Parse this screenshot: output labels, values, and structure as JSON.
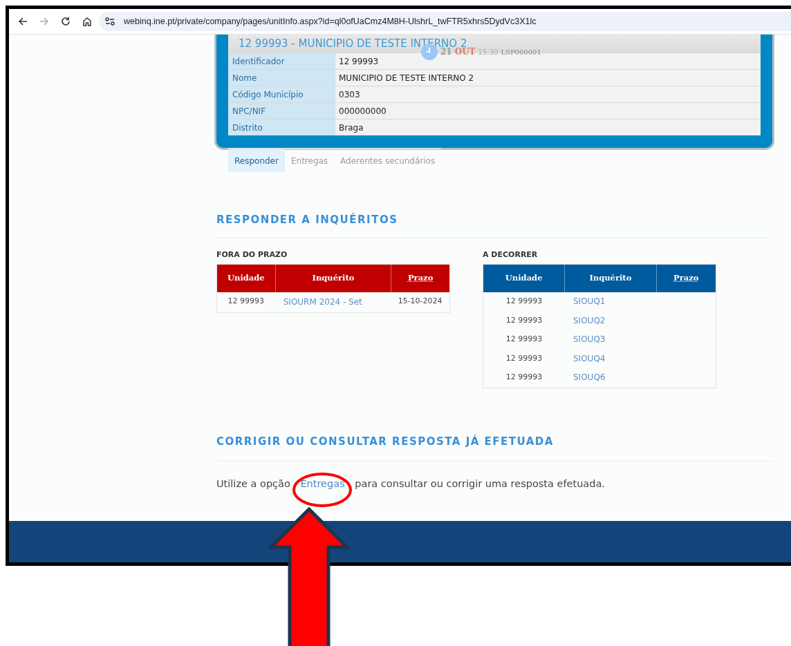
{
  "browser": {
    "url": "webinq.ine.pt/private/company/pages/unitInfo.aspx?id=ql0ofUaCmz4M8H-UlshrL_twFTR5xhrs5DydVc3X1lc",
    "back_disabled": false,
    "forward_disabled": true
  },
  "unit_card": {
    "title": "12 99993 - MUNICIPIO DE TESTE INTERNO 2",
    "clock": {
      "day": "21",
      "month": "OUT",
      "time": "15:30",
      "code": "LSP000001"
    },
    "fields": [
      {
        "label": "Identificador",
        "value": "12 99993"
      },
      {
        "label": "Nome",
        "value": "MUNICIPIO DE TESTE INTERNO 2"
      },
      {
        "label": "Código Município",
        "value": "0303"
      },
      {
        "label": "NPC/NIF",
        "value": "000000000"
      },
      {
        "label": "Distrito",
        "value": "Braga"
      }
    ]
  },
  "tabs": [
    {
      "label": "Responder",
      "selected": true
    },
    {
      "label": "Entregas",
      "selected": false
    },
    {
      "label": "Aderentes secundários",
      "selected": false
    }
  ],
  "responder": {
    "heading": "RESPONDER A INQUÉRITOS",
    "tables": [
      {
        "kind": "overdue",
        "title": "FORA DO PRAZO",
        "columns": [
          "Unidade",
          "Inquérito",
          "Prazo"
        ],
        "rows": [
          {
            "unit": "12 99993",
            "survey": "SIOURM 2024 - Set",
            "deadline": "15-10-2024"
          }
        ]
      },
      {
        "kind": "ongoing",
        "title": "A DECORRER",
        "columns": [
          "Unidade",
          "Inquérito",
          "Prazo"
        ],
        "rows": [
          {
            "unit": "12 99993",
            "survey": "SIOUQ1"
          },
          {
            "unit": "12 99993",
            "survey": "SIOUQ2"
          },
          {
            "unit": "12 99993",
            "survey": "SIOUQ3"
          },
          {
            "unit": "12 99993",
            "survey": "SIOUQ4"
          },
          {
            "unit": "12 99993",
            "survey": "SIOUQ6"
          }
        ]
      }
    ]
  },
  "corrigir": {
    "heading": "CORRIGIR OU CONSULTAR RESPOSTA JÁ EFETUADA",
    "text_before": "Utilize a opção",
    "link": "Entregas",
    "text_after": "para consultar ou corrigir uma resposta efetuada."
  }
}
